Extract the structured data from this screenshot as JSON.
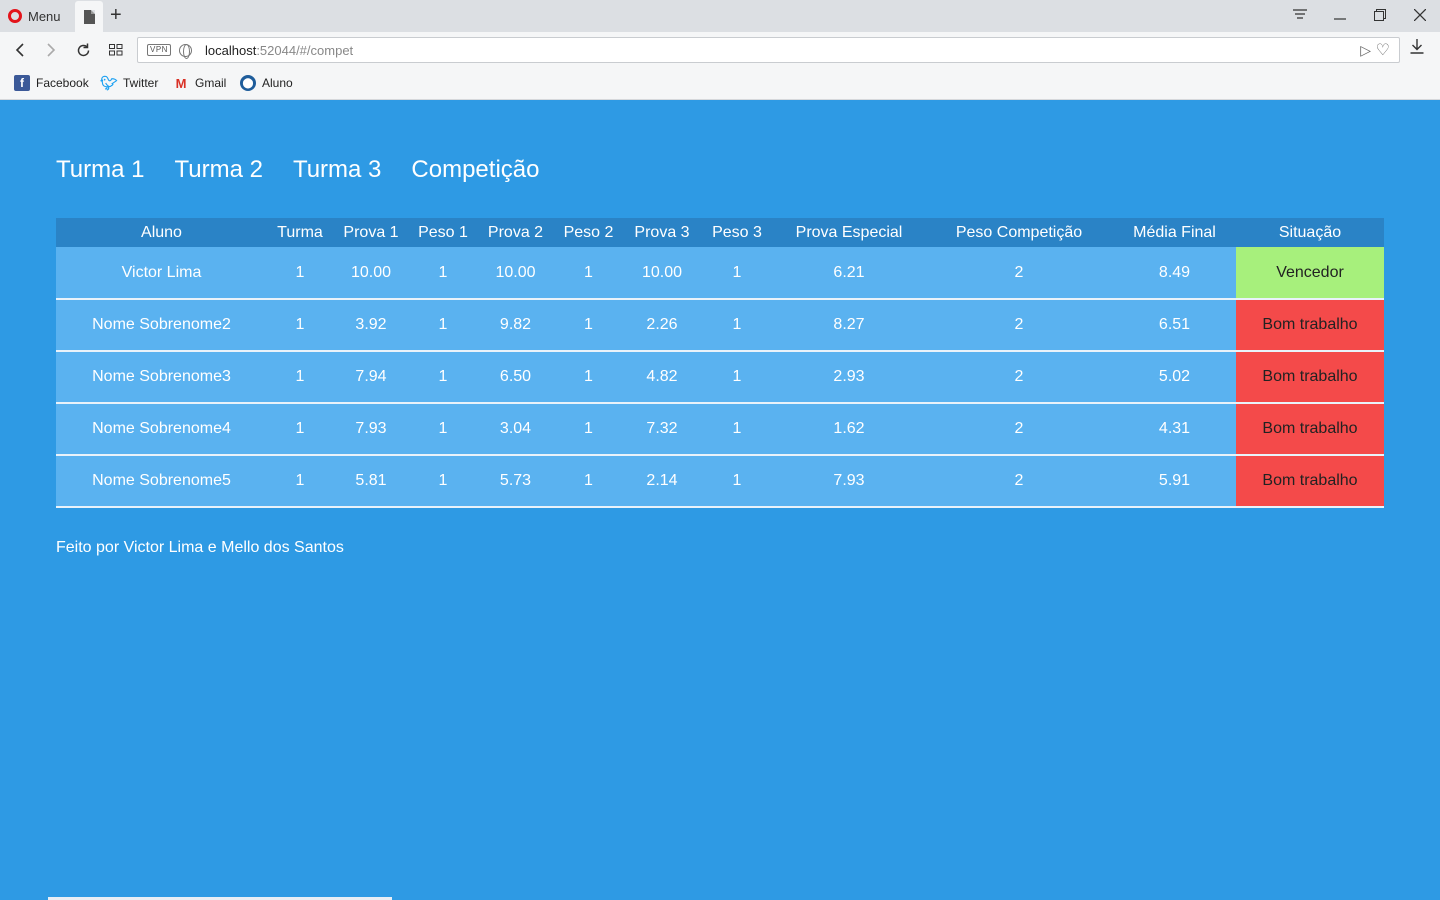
{
  "browser": {
    "menu_label": "Menu",
    "url_host": "localhost",
    "url_rest": ":52044/#/compet",
    "vpn_label": "VPN",
    "bookmarks": [
      {
        "label": "Facebook",
        "icon": "facebook-icon"
      },
      {
        "label": "Twitter",
        "icon": "twitter-icon"
      },
      {
        "label": "Gmail",
        "icon": "gmail-icon"
      },
      {
        "label": "Aluno",
        "icon": "aluno-icon"
      }
    ]
  },
  "nav": {
    "items": [
      "Turma 1",
      "Turma 2",
      "Turma 3",
      "Competição"
    ]
  },
  "table": {
    "headers": [
      "Aluno",
      "Turma",
      "Prova 1",
      "Peso 1",
      "Prova 2",
      "Peso 2",
      "Prova 3",
      "Peso 3",
      "Prova Especial",
      "Peso Competição",
      "Média Final",
      "Situação"
    ],
    "rows": [
      {
        "cells": [
          "Victor Lima",
          "1",
          "10.00",
          "1",
          "10.00",
          "1",
          "10.00",
          "1",
          "6.21",
          "2",
          "8.49",
          "Vencedor"
        ],
        "status_color": "#a7f07c"
      },
      {
        "cells": [
          "Nome Sobrenome2",
          "1",
          "3.92",
          "1",
          "9.82",
          "1",
          "2.26",
          "1",
          "8.27",
          "2",
          "6.51",
          "Bom trabalho"
        ],
        "status_color": "#f44a4a"
      },
      {
        "cells": [
          "Nome Sobrenome3",
          "1",
          "7.94",
          "1",
          "6.50",
          "1",
          "4.82",
          "1",
          "2.93",
          "2",
          "5.02",
          "Bom trabalho"
        ],
        "status_color": "#f44a4a"
      },
      {
        "cells": [
          "Nome Sobrenome4",
          "1",
          "7.93",
          "1",
          "3.04",
          "1",
          "7.32",
          "1",
          "1.62",
          "2",
          "4.31",
          "Bom trabalho"
        ],
        "status_color": "#f44a4a"
      },
      {
        "cells": [
          "Nome Sobrenome5",
          "1",
          "5.81",
          "1",
          "5.73",
          "1",
          "2.14",
          "1",
          "7.93",
          "2",
          "5.91",
          "Bom trabalho"
        ],
        "status_color": "#f44a4a"
      }
    ]
  },
  "footer": {
    "text": "Feito por Victor Lima e Mello dos Santos"
  },
  "colors": {
    "page_bg": "#2e9ae4",
    "header_bg": "#2a83c6",
    "row_bg": "#5ab2f0",
    "winner": "#a7f07c",
    "other": "#f44a4a"
  }
}
